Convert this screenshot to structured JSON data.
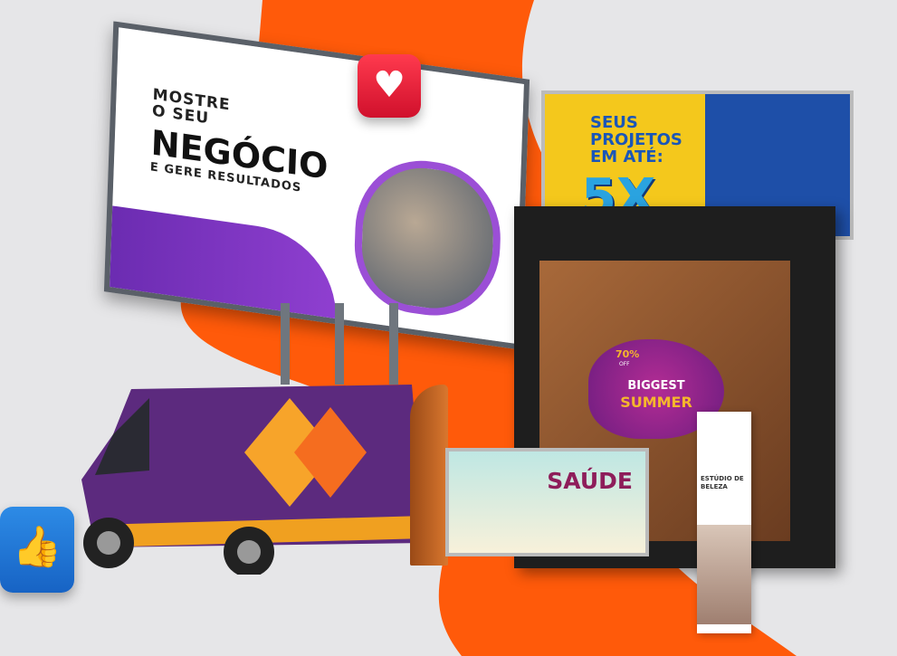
{
  "billboard": {
    "line1": "MOSTRE",
    "line1b": "O SEU",
    "line2": "NEGÓCIO",
    "line3": "E GERE RESULTADOS"
  },
  "banner": {
    "title_lines": [
      "SEUS",
      "PROJETOS",
      "EM ATÉ:"
    ],
    "highlight": "5X"
  },
  "window_sign": {
    "discount": "70%",
    "off": "OFF",
    "line1": "BIGGEST",
    "line2": "SUMMER"
  },
  "barrier_banner": {
    "title": "SAÚDE"
  },
  "rollup": {
    "line1": "ESTÚDIO DE",
    "line2": "BELEZA"
  },
  "icons": [
    "heart-icon",
    "thumbs-up-icon"
  ],
  "colors": {
    "orange": "#ff5a0a",
    "purple": "#6a2bb0",
    "yellow": "#f4c81c",
    "blue": "#1e4fa8"
  }
}
